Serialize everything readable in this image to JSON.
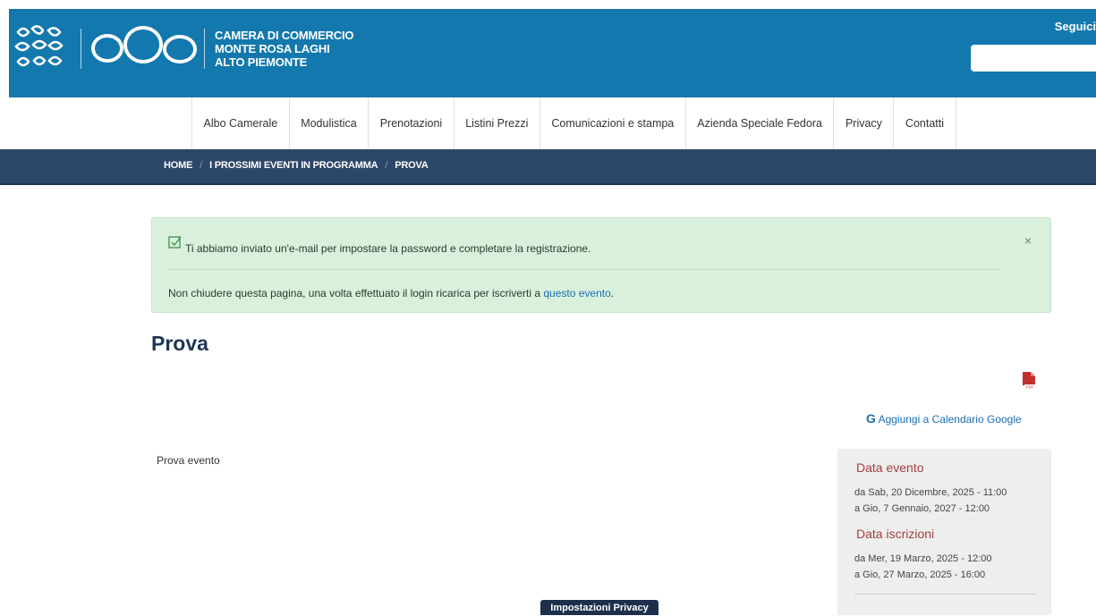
{
  "header": {
    "org_line1": "CAMERA DI COMMERCIO",
    "org_line2": "MONTE ROSA LAGHI",
    "org_line3": "ALTO PIEMONTE",
    "seguici": "Seguici",
    "search_value": "",
    "brand_color": "#1378ae"
  },
  "nav": {
    "items": [
      "Albo Camerale",
      "Modulistica",
      "Prenotazioni",
      "Listini Prezzi",
      "Comunicazioni e stampa",
      "Azienda Speciale Fedora",
      "Privacy",
      "Contatti"
    ]
  },
  "breadcrumb": {
    "items": [
      "HOME",
      "I PROSSIMI EVENTI IN PROGRAMMA",
      "PROVA"
    ],
    "separator": "/"
  },
  "alert": {
    "message1": "Ti abbiamo inviato un'e-mail per impostare la password e completare la registrazione.",
    "message2_prefix": "Non chiudere questa pagina, una volta effettuato il login ricarica per iscriverti a ",
    "message2_link": "questo evento",
    "message2_suffix": ".",
    "close_symbol": "×",
    "bg_color": "#d9f1dc"
  },
  "page": {
    "title": "Prova",
    "pdf_icon": "pdf-icon",
    "gcal_g": "G",
    "gcal_label": "Aggiungi a Calendario Google",
    "description": "Prova evento"
  },
  "event_box": {
    "date_heading": "Data evento",
    "date_from": "da Sab, 20 Dicembre, 2025 - 11:00",
    "date_to": "a Gio, 7 Gennaio, 2027 - 12:00",
    "reg_heading": "Data iscrizioni",
    "reg_from": "da Mer, 19 Marzo, 2025 - 12:00",
    "reg_to": "a Gio, 27 Marzo, 2025 - 16:00"
  },
  "privacy_button": "Impostazioni Privacy"
}
